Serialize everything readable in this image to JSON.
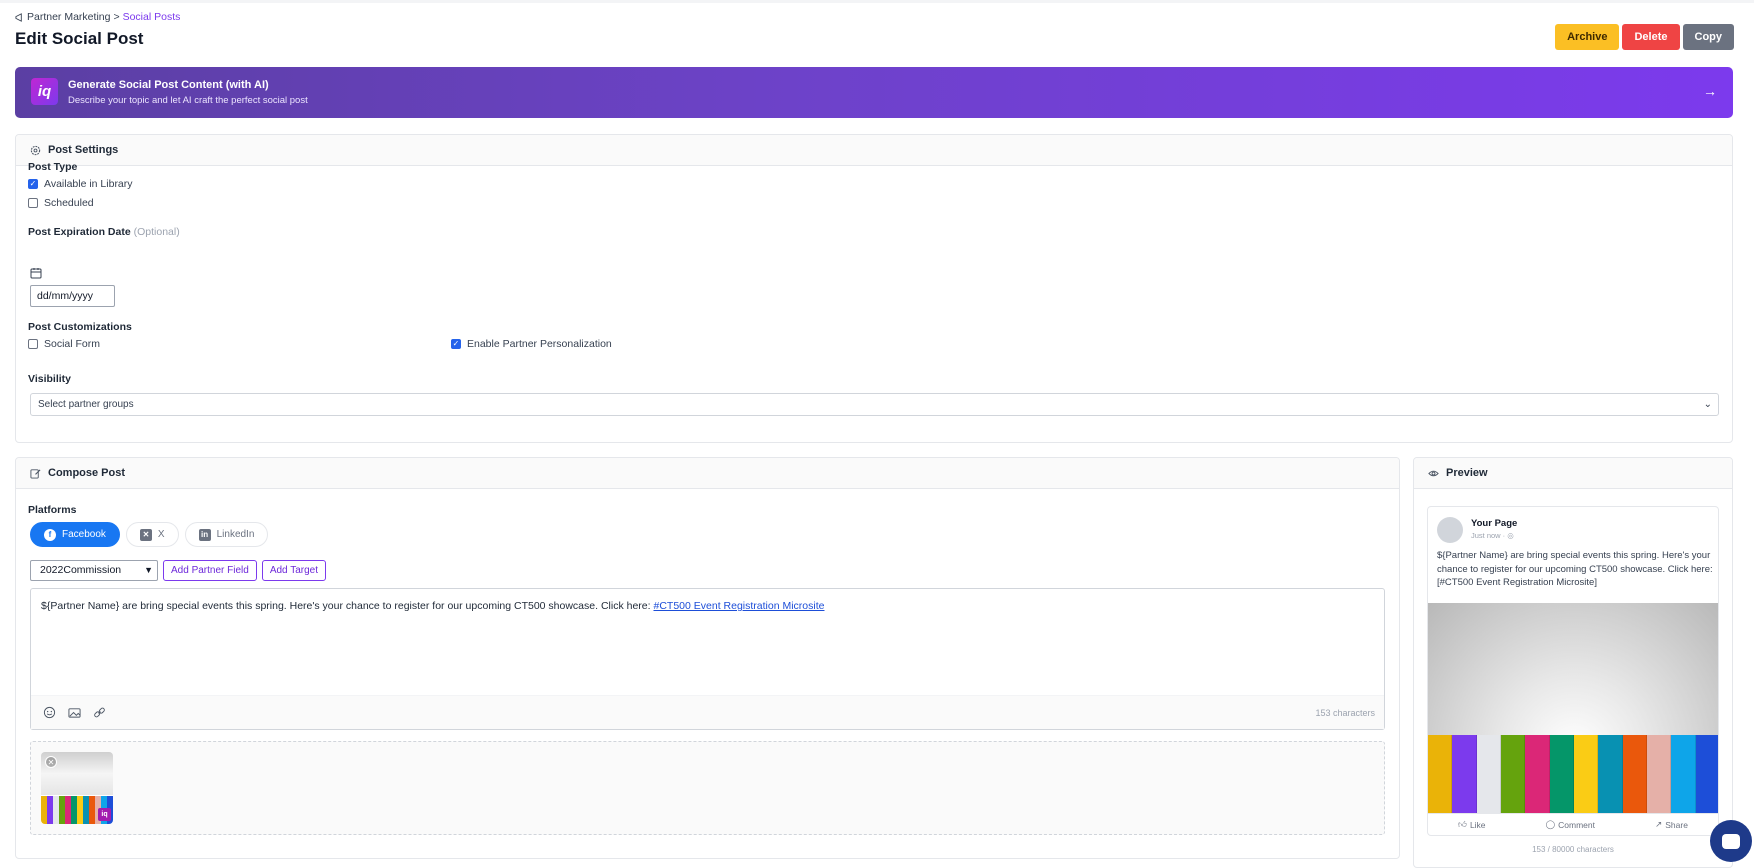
{
  "breadcrumb": {
    "parent": "Partner Marketing",
    "separator": ">",
    "current": "Social Posts"
  },
  "page_title": "Edit Social Post",
  "actions": {
    "archive": "Archive",
    "delete": "Delete",
    "copy": "Copy"
  },
  "ai_banner": {
    "logo": "iq",
    "title": "Generate Social Post Content (with AI)",
    "subtitle": "Describe your topic and let AI craft the perfect social post",
    "arrow": "→"
  },
  "settings": {
    "header": "Post Settings",
    "post_type_label": "Post Type",
    "available_in_library": "Available in Library",
    "scheduled": "Scheduled",
    "expiration_label": "Post Expiration Date",
    "expiration_optional": "(Optional)",
    "date_placeholder": "dd/mm/yyyy",
    "customizations_label": "Post Customizations",
    "social_form": "Social Form",
    "enable_personalization": "Enable Partner Personalization",
    "visibility_label": "Visibility",
    "visibility_select": "Select partner groups"
  },
  "compose": {
    "header": "Compose Post",
    "platforms_label": "Platforms",
    "platforms": [
      "Facebook",
      "X",
      "LinkedIn"
    ],
    "commission_select": "2022Commission",
    "add_partner_field": "Add Partner Field",
    "add_target": "Add Target",
    "body_text": "${Partner Name} are bring special events this spring. Here's your chance to register for our upcoming CT500 showcase. Click here:",
    "body_link": "#CT500 Event Registration Microsite",
    "char_count": "153 characters"
  },
  "preview": {
    "header": "Preview",
    "page_name": "Your Page",
    "time": "Just now · ◎",
    "text": "${Partner Name} are bring special events this spring. Here's your chance to register for our upcoming CT500 showcase. Click here: [#CT500 Event Registration Microsite]",
    "like": "Like",
    "comment": "Comment",
    "share": "Share",
    "char_count": "153 / 80000 characters"
  },
  "colors": {
    "accent": "#7c3aed",
    "facebook": "#1877f2",
    "archive": "#fbbf24",
    "delete": "#ef4444",
    "copy": "#6b7280"
  },
  "book_colors": [
    "#eab308",
    "#7c3aed",
    "#e5e7eb",
    "#65a30d",
    "#db2777",
    "#059669",
    "#facc15",
    "#0891b2",
    "#ea580c",
    "#e5b0a8",
    "#0ea5e9",
    "#1d4ed8"
  ]
}
